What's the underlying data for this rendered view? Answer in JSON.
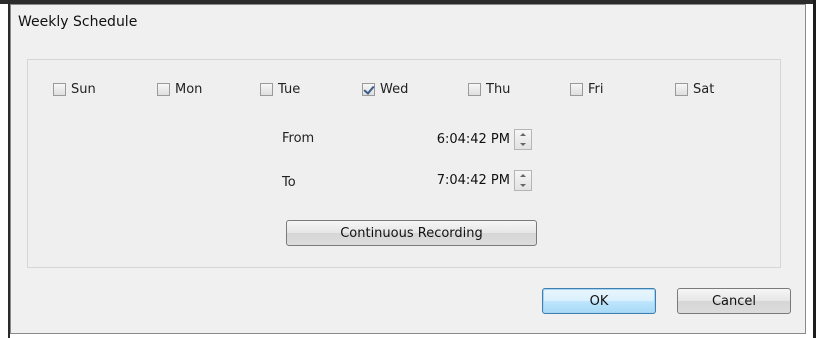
{
  "dialog": {
    "title": "Weekly Schedule"
  },
  "days": [
    {
      "label": "Sun",
      "checked": false
    },
    {
      "label": "Mon",
      "checked": false
    },
    {
      "label": "Tue",
      "checked": false
    },
    {
      "label": "Wed",
      "checked": true
    },
    {
      "label": "Thu",
      "checked": false
    },
    {
      "label": "Fri",
      "checked": false
    },
    {
      "label": "Sat",
      "checked": false
    }
  ],
  "time": {
    "from_label": "From",
    "from_value": "6:04:42 PM",
    "to_label": "To",
    "to_value": "7:04:42 PM"
  },
  "buttons": {
    "continuous": "Continuous Recording",
    "ok": "OK",
    "cancel": "Cancel"
  }
}
